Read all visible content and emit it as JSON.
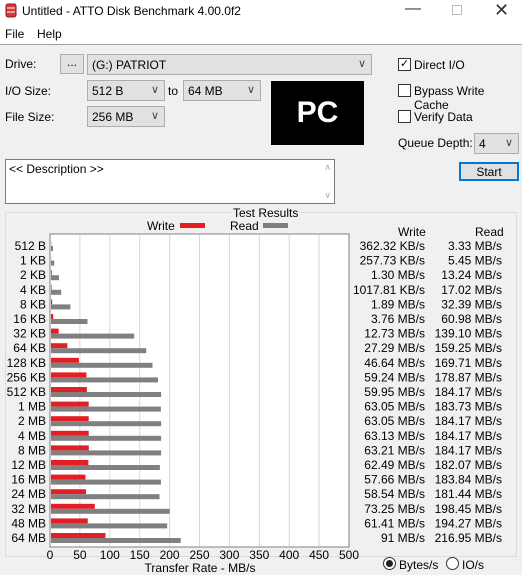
{
  "window": {
    "title": "Untitled - ATTO Disk Benchmark 4.00.0f2"
  },
  "menu": [
    "File",
    "Help"
  ],
  "controls": {
    "drive_label": "Drive:",
    "browse_label": "...",
    "drive_value": "(G:) PATRIOT",
    "io_size_label": "I/O Size:",
    "io_from": "512 B",
    "to_label": "to",
    "io_to": "64 MB",
    "file_size_label": "File Size:",
    "file_size": "256 MB",
    "logo_text": "PC",
    "direct_io": {
      "label": "Direct I/O",
      "checked": true
    },
    "bypass_write_cache": {
      "label": "Bypass Write Cache",
      "checked": false
    },
    "verify_data": {
      "label": "Verify Data",
      "checked": false
    },
    "queue_depth_label": "Queue Depth:",
    "queue_depth": "4",
    "description": "<< Description >>",
    "start_label": "Start"
  },
  "results": {
    "group_title": "Test Results",
    "write_header": "Write",
    "read_header": "Read",
    "units": {
      "bytes": "Bytes/s",
      "io": "IO/s",
      "selected": "bytes"
    }
  },
  "chart_data": {
    "type": "bar",
    "orientation": "horizontal",
    "xlabel": "Transfer Rate - MB/s",
    "xlim": [
      0,
      500
    ],
    "xticks": [
      "0",
      "50",
      "100",
      "150",
      "200",
      "250",
      "300",
      "350",
      "400",
      "450",
      "500"
    ],
    "grid": true,
    "legend_placement": "top",
    "categories": [
      "512 B",
      "1 KB",
      "2 KB",
      "4 KB",
      "8 KB",
      "16 KB",
      "32 KB",
      "64 KB",
      "128 KB",
      "256 KB",
      "512 KB",
      "1 MB",
      "2 MB",
      "4 MB",
      "8 MB",
      "12 MB",
      "16 MB",
      "24 MB",
      "32 MB",
      "48 MB",
      "64 MB"
    ],
    "series": [
      {
        "name": "Write",
        "color": "#e31e24",
        "values": [
          0.354,
          0.252,
          1.3,
          0.993,
          1.89,
          3.76,
          12.73,
          27.29,
          46.64,
          59.24,
          59.95,
          63.05,
          63.05,
          63.13,
          63.21,
          62.49,
          57.66,
          58.54,
          73.25,
          61.41,
          91
        ],
        "labels": [
          "362.32 KB/s",
          "257.73 KB/s",
          "1.30 MB/s",
          "1017.81 KB/s",
          "1.89 MB/s",
          "3.76 MB/s",
          "12.73 MB/s",
          "27.29 MB/s",
          "46.64 MB/s",
          "59.24 MB/s",
          "59.95 MB/s",
          "63.05 MB/s",
          "63.05 MB/s",
          "63.13 MB/s",
          "63.21 MB/s",
          "62.49 MB/s",
          "57.66 MB/s",
          "58.54 MB/s",
          "73.25 MB/s",
          "61.41 MB/s",
          "91 MB/s"
        ]
      },
      {
        "name": "Read",
        "color": "#808080",
        "values": [
          3.33,
          5.45,
          13.24,
          17.02,
          32.39,
          60.98,
          139.1,
          159.25,
          169.71,
          178.87,
          184.17,
          183.73,
          184.17,
          184.17,
          184.17,
          182.07,
          183.84,
          181.44,
          198.45,
          194.27,
          216.95
        ],
        "labels": [
          "3.33 MB/s",
          "5.45 MB/s",
          "13.24 MB/s",
          "17.02 MB/s",
          "32.39 MB/s",
          "60.98 MB/s",
          "139.10 MB/s",
          "159.25 MB/s",
          "169.71 MB/s",
          "178.87 MB/s",
          "184.17 MB/s",
          "183.73 MB/s",
          "184.17 MB/s",
          "184.17 MB/s",
          "184.17 MB/s",
          "182.07 MB/s",
          "183.84 MB/s",
          "181.44 MB/s",
          "198.45 MB/s",
          "194.27 MB/s",
          "216.95 MB/s"
        ]
      }
    ]
  }
}
